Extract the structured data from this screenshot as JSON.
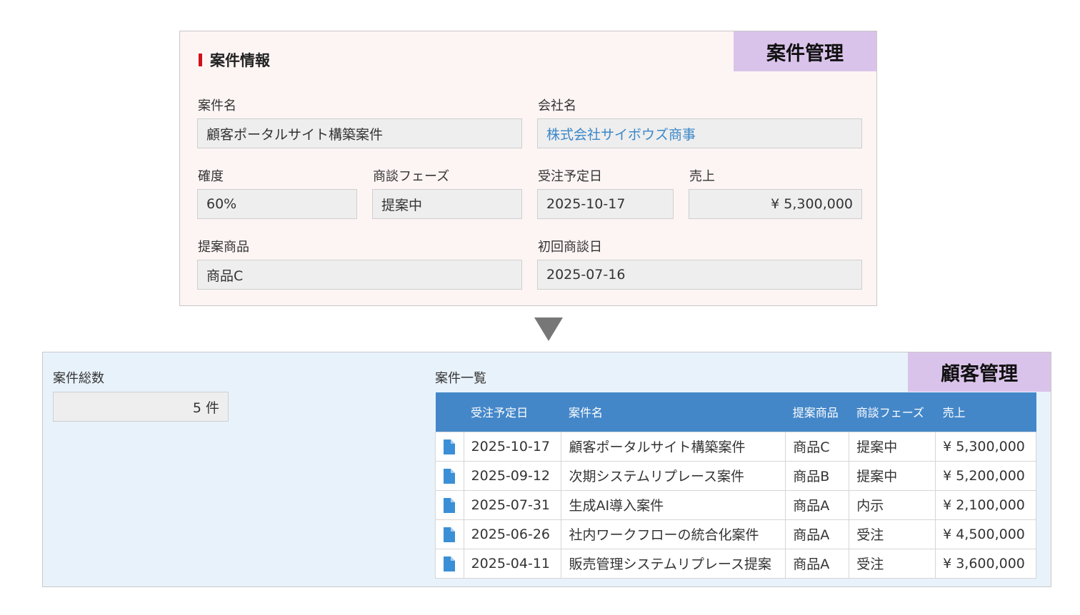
{
  "top_panel": {
    "tag": "案件管理",
    "section_title": "案件情報",
    "fields": {
      "case_name": {
        "label": "案件名",
        "value": "顧客ポータルサイト構築案件"
      },
      "company_name": {
        "label": "会社名",
        "value": "株式会社サイボウズ商事"
      },
      "certainty": {
        "label": "確度",
        "value": "60%"
      },
      "phase": {
        "label": "商談フェーズ",
        "value": "提案中"
      },
      "order_date": {
        "label": "受注予定日",
        "value": "2025-10-17"
      },
      "sales": {
        "label": "売上",
        "value": "¥ 5,300,000"
      },
      "product": {
        "label": "提案商品",
        "value": "商品C"
      },
      "first_meeting": {
        "label": "初回商談日",
        "value": "2025-07-16"
      }
    },
    "accent_color": "#d0101a",
    "link_color": "#3a87c8"
  },
  "bottom_panel": {
    "tag": "顧客管理",
    "total": {
      "label": "案件総数",
      "value": "5 件"
    },
    "list": {
      "label": "案件一覧",
      "columns": [
        "受注予定日",
        "案件名",
        "提案商品",
        "商談フェーズ",
        "売上"
      ],
      "rows": [
        [
          "2025-10-17",
          "顧客ポータルサイト構築案件",
          "商品C",
          "提案中",
          "¥ 5,300,000"
        ],
        [
          "2025-09-12",
          "次期システムリプレース案件",
          "商品B",
          "提案中",
          "¥ 5,200,000"
        ],
        [
          "2025-07-31",
          "生成AI導入案件",
          "商品A",
          "内示",
          "¥ 2,100,000"
        ],
        [
          "2025-06-26",
          "社内ワークフローの統合化案件",
          "商品A",
          "受注",
          "¥ 4,500,000"
        ],
        [
          "2025-04-11",
          "販売管理システムリプレース提案",
          "商品A",
          "受注",
          "¥ 3,600,000"
        ]
      ],
      "header_color": "#4487c9",
      "row_icon": "document-icon"
    }
  }
}
